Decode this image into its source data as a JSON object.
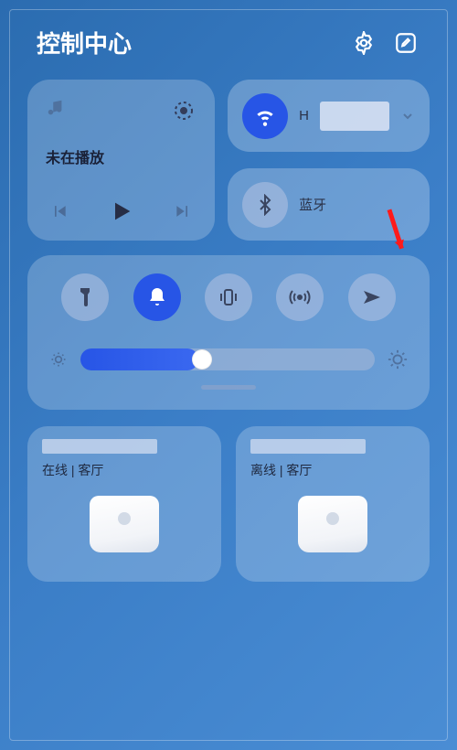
{
  "header": {
    "title": "控制中心"
  },
  "music": {
    "status": "未在播放"
  },
  "wifi": {
    "label": "H",
    "active": true
  },
  "bluetooth": {
    "label": "蓝牙",
    "active": false
  },
  "brightness": {
    "value": 40
  },
  "devices": [
    {
      "status": "在线 | 客厅"
    },
    {
      "status": "离线 | 客厅"
    }
  ]
}
